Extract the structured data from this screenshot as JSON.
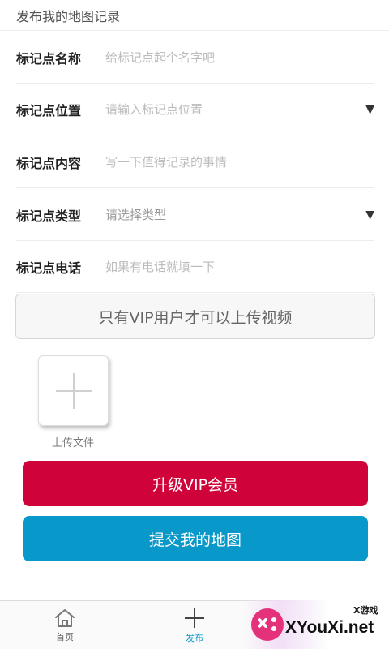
{
  "header": {
    "title": "发布我的地图记录"
  },
  "form": {
    "rows": [
      {
        "label": "标记点名称",
        "placeholder": "给标记点起个名字吧"
      },
      {
        "label": "标记点位置",
        "placeholder": "请输入标记点位置"
      },
      {
        "label": "标记点内容",
        "placeholder": "写一下值得记录的事情"
      },
      {
        "label": "标记点类型",
        "value": "请选择类型"
      },
      {
        "label": "标记点电话",
        "placeholder": "如果有电话就填一下"
      }
    ]
  },
  "video": {
    "notice": "只有VIP用户才可以上传视频"
  },
  "upload": {
    "label": "上传文件"
  },
  "buttons": {
    "upgrade_vip": "升级VIP会员",
    "submit_map": "提交我的地图"
  },
  "bottom_nav": {
    "home_label": "首页",
    "publish_label": "发布"
  },
  "watermark": {
    "small": "X游戏",
    "text": "XYouXi.net"
  },
  "colors": {
    "vip_button": "#d0023a",
    "submit_button": "#0898c9",
    "active_nav": "#0898c9"
  },
  "icons": {
    "dropdown": "triangle-down",
    "home": "house-outline",
    "publish": "plus",
    "upload": "plus"
  }
}
